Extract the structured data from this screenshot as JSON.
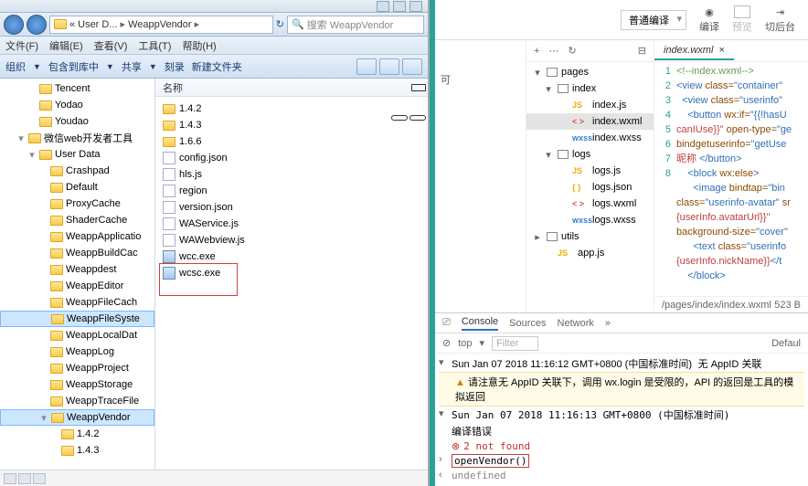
{
  "explorer": {
    "breadcrumb": [
      "«",
      "User D...",
      "WeappVendor",
      ""
    ],
    "search_placeholder": "搜索 WeappVendor",
    "menus": [
      "文件(F)",
      "编辑(E)",
      "查看(V)",
      "工具(T)",
      "帮助(H)"
    ],
    "toolbar": [
      "组织",
      "包含到库中",
      "共享",
      "刻录",
      "新建文件夹"
    ],
    "tree": [
      {
        "pad": 30,
        "exp": "",
        "label": "Tencent"
      },
      {
        "pad": 30,
        "exp": "",
        "label": "Yodao"
      },
      {
        "pad": 30,
        "exp": "",
        "label": "Youdao"
      },
      {
        "pad": 18,
        "exp": "▾",
        "label": "微信web开发者工具"
      },
      {
        "pad": 30,
        "exp": "▾",
        "label": "User Data"
      },
      {
        "pad": 42,
        "exp": "",
        "label": "Crashpad"
      },
      {
        "pad": 42,
        "exp": "",
        "label": "Default"
      },
      {
        "pad": 42,
        "exp": "",
        "label": "ProxyCache"
      },
      {
        "pad": 42,
        "exp": "",
        "label": "ShaderCache"
      },
      {
        "pad": 42,
        "exp": "",
        "label": "WeappApplicatio"
      },
      {
        "pad": 42,
        "exp": "",
        "label": "WeappBuildCac"
      },
      {
        "pad": 42,
        "exp": "",
        "label": "Weappdest"
      },
      {
        "pad": 42,
        "exp": "",
        "label": "WeappEditor"
      },
      {
        "pad": 42,
        "exp": "",
        "label": "WeappFileCach"
      },
      {
        "pad": 42,
        "exp": "",
        "label": "WeappFileSyste",
        "sel": true
      },
      {
        "pad": 42,
        "exp": "",
        "label": "WeappLocalDat"
      },
      {
        "pad": 42,
        "exp": "",
        "label": "WeappLog"
      },
      {
        "pad": 42,
        "exp": "",
        "label": "WeappProject"
      },
      {
        "pad": 42,
        "exp": "",
        "label": "WeappStorage"
      },
      {
        "pad": 42,
        "exp": "",
        "label": "WeappTraceFile"
      },
      {
        "pad": 42,
        "exp": "▾",
        "label": "WeappVendor",
        "sel": true
      },
      {
        "pad": 54,
        "exp": "",
        "label": "1.4.2"
      },
      {
        "pad": 54,
        "exp": "",
        "label": "1.4.3"
      }
    ],
    "col_header": "名称",
    "files": [
      {
        "type": "folder",
        "name": "1.4.2"
      },
      {
        "type": "folder",
        "name": "1.4.3"
      },
      {
        "type": "folder",
        "name": "1.6.6"
      },
      {
        "type": "file",
        "name": "config.json"
      },
      {
        "type": "file",
        "name": "hls.js"
      },
      {
        "type": "file",
        "name": "region"
      },
      {
        "type": "file",
        "name": "version.json"
      },
      {
        "type": "file",
        "name": "WAService.js"
      },
      {
        "type": "file",
        "name": "WAWebview.js"
      },
      {
        "type": "exe",
        "name": "wcc.exe"
      },
      {
        "type": "exe",
        "name": "wcsc.exe"
      }
    ]
  },
  "devtools": {
    "compile_dropdown": "普通编译",
    "top_actions": {
      "compile": "编译",
      "preview": "预览",
      "backend": "切后台"
    },
    "tree_tb_icons": [
      "+",
      "⋯",
      "↻",
      "⊟"
    ],
    "project_tree": [
      {
        "pad": 2,
        "exp": "▾",
        "icon": "fold",
        "label": "pages"
      },
      {
        "pad": 14,
        "exp": "▾",
        "icon": "fold",
        "label": "index"
      },
      {
        "pad": 30,
        "exp": "",
        "icon": "js",
        "label": "index.js"
      },
      {
        "pad": 30,
        "exp": "",
        "icon": "wxml",
        "label": "index.wxml",
        "sel": true
      },
      {
        "pad": 30,
        "exp": "",
        "icon": "wxss",
        "label": "index.wxss"
      },
      {
        "pad": 14,
        "exp": "▾",
        "icon": "fold",
        "label": "logs"
      },
      {
        "pad": 30,
        "exp": "",
        "icon": "js",
        "label": "logs.js"
      },
      {
        "pad": 30,
        "exp": "",
        "icon": "json",
        "label": "logs.json"
      },
      {
        "pad": 30,
        "exp": "",
        "icon": "wxml",
        "label": "logs.wxml"
      },
      {
        "pad": 30,
        "exp": "",
        "icon": "wxss",
        "label": "logs.wxss"
      },
      {
        "pad": 2,
        "exp": "▸",
        "icon": "fold",
        "label": "utils"
      },
      {
        "pad": 14,
        "exp": "",
        "icon": "js",
        "label": "app.js"
      }
    ],
    "open_tab": "index.wxml",
    "code_status": {
      "path": "/pages/index/index.wxml",
      "size": "523 B"
    },
    "code_lines": [
      {
        "n": 1,
        "html": "<span class='c-comm'>&lt;!--index.wxml--&gt;</span>"
      },
      {
        "n": 2,
        "html": "<span class='c-tag'>&lt;view</span> <span class='c-attr'>class=</span><span class='c-str'>\"container\"</span>"
      },
      {
        "n": 3,
        "html": "  <span class='c-tag'>&lt;view</span> <span class='c-attr'>class=</span><span class='c-str'>\"userinfo\"</span>"
      },
      {
        "n": 4,
        "html": "    <span class='c-tag'>&lt;button</span> <span class='c-attr'>wx:if=</span><span class='c-str'>\"{{!hasU</span>"
      },
      {
        "n": "",
        "html": "<span class='c-red'>canIUse}}\"</span> <span class='c-attr'>open-type=</span><span class='c-str'>\"ge</span>"
      },
      {
        "n": "",
        "html": "<span class='c-attr'>bindgetuserinfo=</span><span class='c-str'>\"getUse</span>"
      },
      {
        "n": "",
        "html": "<span class='c-red'>昵称</span> <span class='c-tag'>&lt;/button&gt;</span>"
      },
      {
        "n": 5,
        "html": "    <span class='c-tag'>&lt;block</span> <span class='c-attr'>wx:else</span><span class='c-tag'>&gt;</span>"
      },
      {
        "n": 6,
        "html": "      <span class='c-tag'>&lt;image</span> <span class='c-attr'>bindtap=</span><span class='c-str'>\"bin</span>"
      },
      {
        "n": "",
        "html": "<span class='c-attr'>class=</span><span class='c-str'>\"userinfo-avatar\"</span> <span class='c-attr'>sr</span>"
      },
      {
        "n": "",
        "html": "<span class='c-red'>{userInfo.avatarUrl}}\"</span>"
      },
      {
        "n": "",
        "html": "<span class='c-attr'>background-size=</span><span class='c-str'>\"cover\"</span>"
      },
      {
        "n": 7,
        "html": "      <span class='c-tag'>&lt;text</span> <span class='c-attr'>class=</span><span class='c-str'>\"userinfo</span>"
      },
      {
        "n": "",
        "html": "<span class='c-red'>{userInfo.nickName}}</span><span class='c-tag'>&lt;/t</span>"
      },
      {
        "n": 8,
        "html": "    <span class='c-tag'>&lt;/block&gt;</span>"
      }
    ],
    "left_label": "可",
    "console": {
      "tabs": [
        "Console",
        "Sources",
        "Network"
      ],
      "filter_scope": "top",
      "filter_placeholder": "Filter",
      "filter_default": "Defaul",
      "log1_ts": "Sun Jan 07 2018 11:16:12 GMT+0800 (中国标准时间)",
      "log1_suffix": "无 AppID 关联",
      "warn_text": "请注意无 AppID 关联下，调用 wx.login 是受限的，API 的返回是工具的模拟返回",
      "log2_ts": "Sun Jan 07 2018 11:16:13 GMT+0800 (中国标准时间)",
      "log2_msg": "编译错误",
      "err_text": "2 not found",
      "prompt": "openVendor()",
      "result": "undefined"
    }
  }
}
